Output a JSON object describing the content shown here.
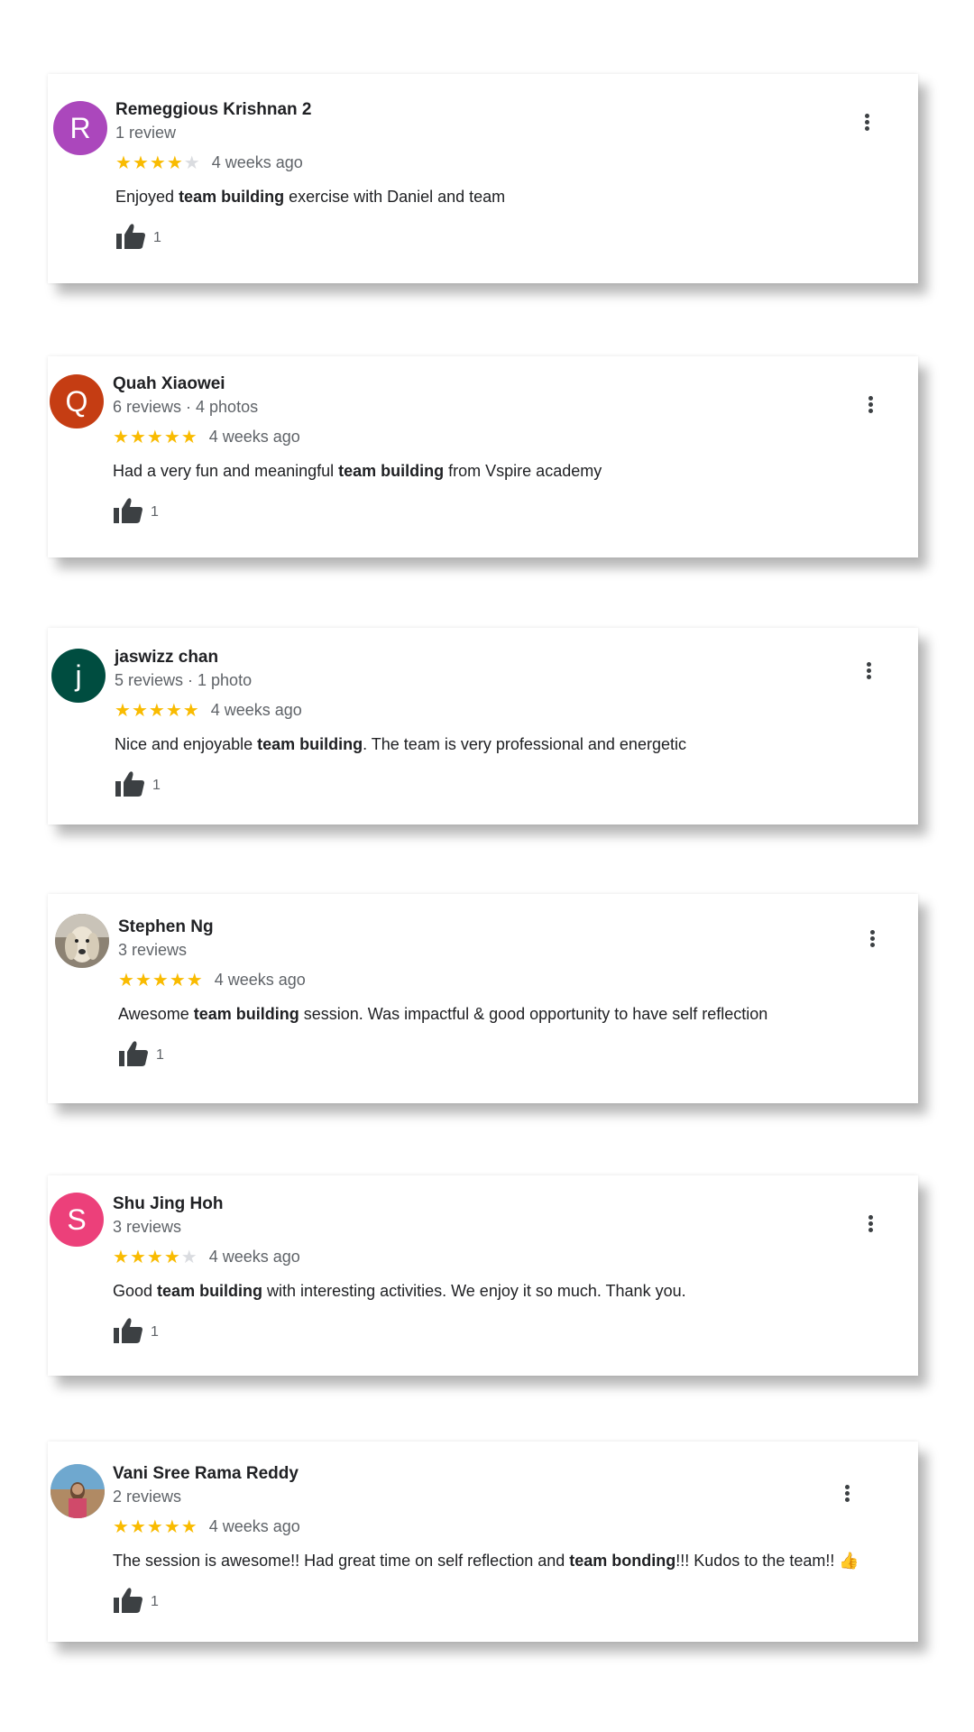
{
  "colors": {
    "star_filled": "#f9bb00",
    "star_empty": "#dadce0",
    "text_primary": "#202124",
    "text_secondary": "#5f6368"
  },
  "reviews": [
    {
      "avatar_letter": "R",
      "avatar_color": "#ab47bc",
      "name": "Remeggious Krishnan 2",
      "meta": "1 review",
      "rating": 4,
      "date": "4 weeks ago",
      "text_before": "Enjoyed ",
      "text_bold": "team building",
      "text_after": " exercise with Daniel and team",
      "likes": "1",
      "like_icon": "thumbs-up-icon",
      "menu_icon": "more-vert-icon"
    },
    {
      "avatar_letter": "Q",
      "avatar_color": "#c53d13",
      "name": "Quah Xiaowei",
      "meta": "6 reviews · 4 photos",
      "rating": 5,
      "date": "4 weeks ago",
      "text_before": "Had a very fun and meaningful ",
      "text_bold": "team building",
      "text_after": " from Vspire academy",
      "likes": "1",
      "like_icon": "thumbs-up-icon",
      "menu_icon": "more-vert-icon"
    },
    {
      "avatar_letter": "j",
      "avatar_color": "#004d40",
      "name": "jaswizz chan",
      "meta": "5 reviews · 1 photo",
      "rating": 5,
      "date": "4 weeks ago",
      "text_before": "Nice and enjoyable ",
      "text_bold": "team building",
      "text_after": ". The team is very professional and energetic",
      "likes": "1",
      "like_icon": "thumbs-up-icon",
      "menu_icon": "more-vert-icon"
    },
    {
      "avatar_letter": "",
      "avatar_color": "#cfcfcf",
      "name": "Stephen Ng",
      "meta": "3 reviews",
      "rating": 5,
      "date": "4 weeks ago",
      "text_before": "Awesome ",
      "text_bold": "team building",
      "text_after": " session. Was impactful & good opportunity to have self reflection",
      "likes": "1",
      "like_icon": "thumbs-up-icon",
      "menu_icon": "more-vert-icon"
    },
    {
      "avatar_letter": "S",
      "avatar_color": "#ec407a",
      "name": "Shu Jing Hoh",
      "meta": "3 reviews",
      "rating": 4,
      "date": "4 weeks ago",
      "text_before": "Good ",
      "text_bold": "team building",
      "text_after": " with interesting activities. We enjoy it so much. Thank you.",
      "likes": "1",
      "like_icon": "thumbs-up-icon",
      "menu_icon": "more-vert-icon"
    },
    {
      "avatar_letter": "",
      "avatar_color": "#cfcfcf",
      "name": "Vani Sree Rama Reddy",
      "meta": "2 reviews",
      "rating": 5,
      "date": "4 weeks ago",
      "text_before": "The session is awesome!! Had great time on self reflection and ",
      "text_bold": "team bonding",
      "text_after": "!!! Kudos to the team!! 👍",
      "likes": "1",
      "like_icon": "thumbs-up-icon",
      "menu_icon": "more-vert-icon"
    }
  ]
}
